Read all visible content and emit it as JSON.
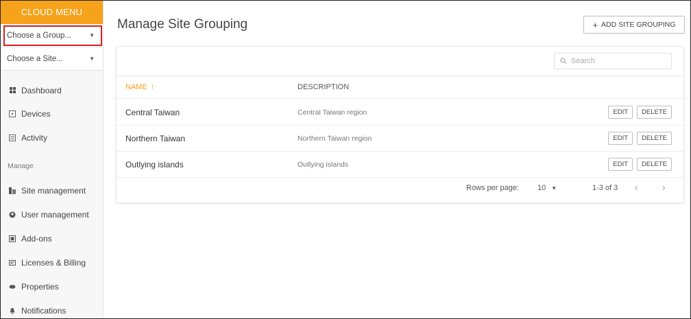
{
  "sidebar": {
    "header": "CLOUD MENU",
    "group_select": "Choose a Group...",
    "site_select": "Choose a Site...",
    "nav_top": [
      {
        "label": "Dashboard",
        "icon": "dashboard-icon"
      },
      {
        "label": "Devices",
        "icon": "devices-icon"
      },
      {
        "label": "Activity",
        "icon": "activity-icon"
      }
    ],
    "section_label": "Manage",
    "nav_manage": [
      {
        "label": "Site management",
        "icon": "site-management-icon"
      },
      {
        "label": "User management",
        "icon": "user-management-icon"
      },
      {
        "label": "Add-ons",
        "icon": "add-ons-icon"
      },
      {
        "label": "Licenses & Billing",
        "icon": "licenses-icon"
      },
      {
        "label": "Properties",
        "icon": "properties-icon"
      },
      {
        "label": "Notifications",
        "icon": "bell-icon"
      }
    ]
  },
  "main": {
    "title": "Manage Site Grouping",
    "add_button": "ADD SITE GROUPING",
    "search_placeholder": "Search",
    "columns": {
      "name": "NAME",
      "description": "DESCRIPTION"
    },
    "rows": [
      {
        "name": "Central Taiwan",
        "description": "Central Taiwan region"
      },
      {
        "name": "Northern Taiwan",
        "description": "Northern Taiwan region"
      },
      {
        "name": "Outlying islands",
        "description": "Outlying islands"
      }
    ],
    "row_actions": {
      "edit": "EDIT",
      "delete": "DELETE"
    },
    "footer": {
      "rows_per_page_label": "Rows per page:",
      "rows_per_page_value": "10",
      "range": "1-3 of 3"
    }
  },
  "colors": {
    "accent": "#f6a21a",
    "highlight": "#d31f1f"
  }
}
